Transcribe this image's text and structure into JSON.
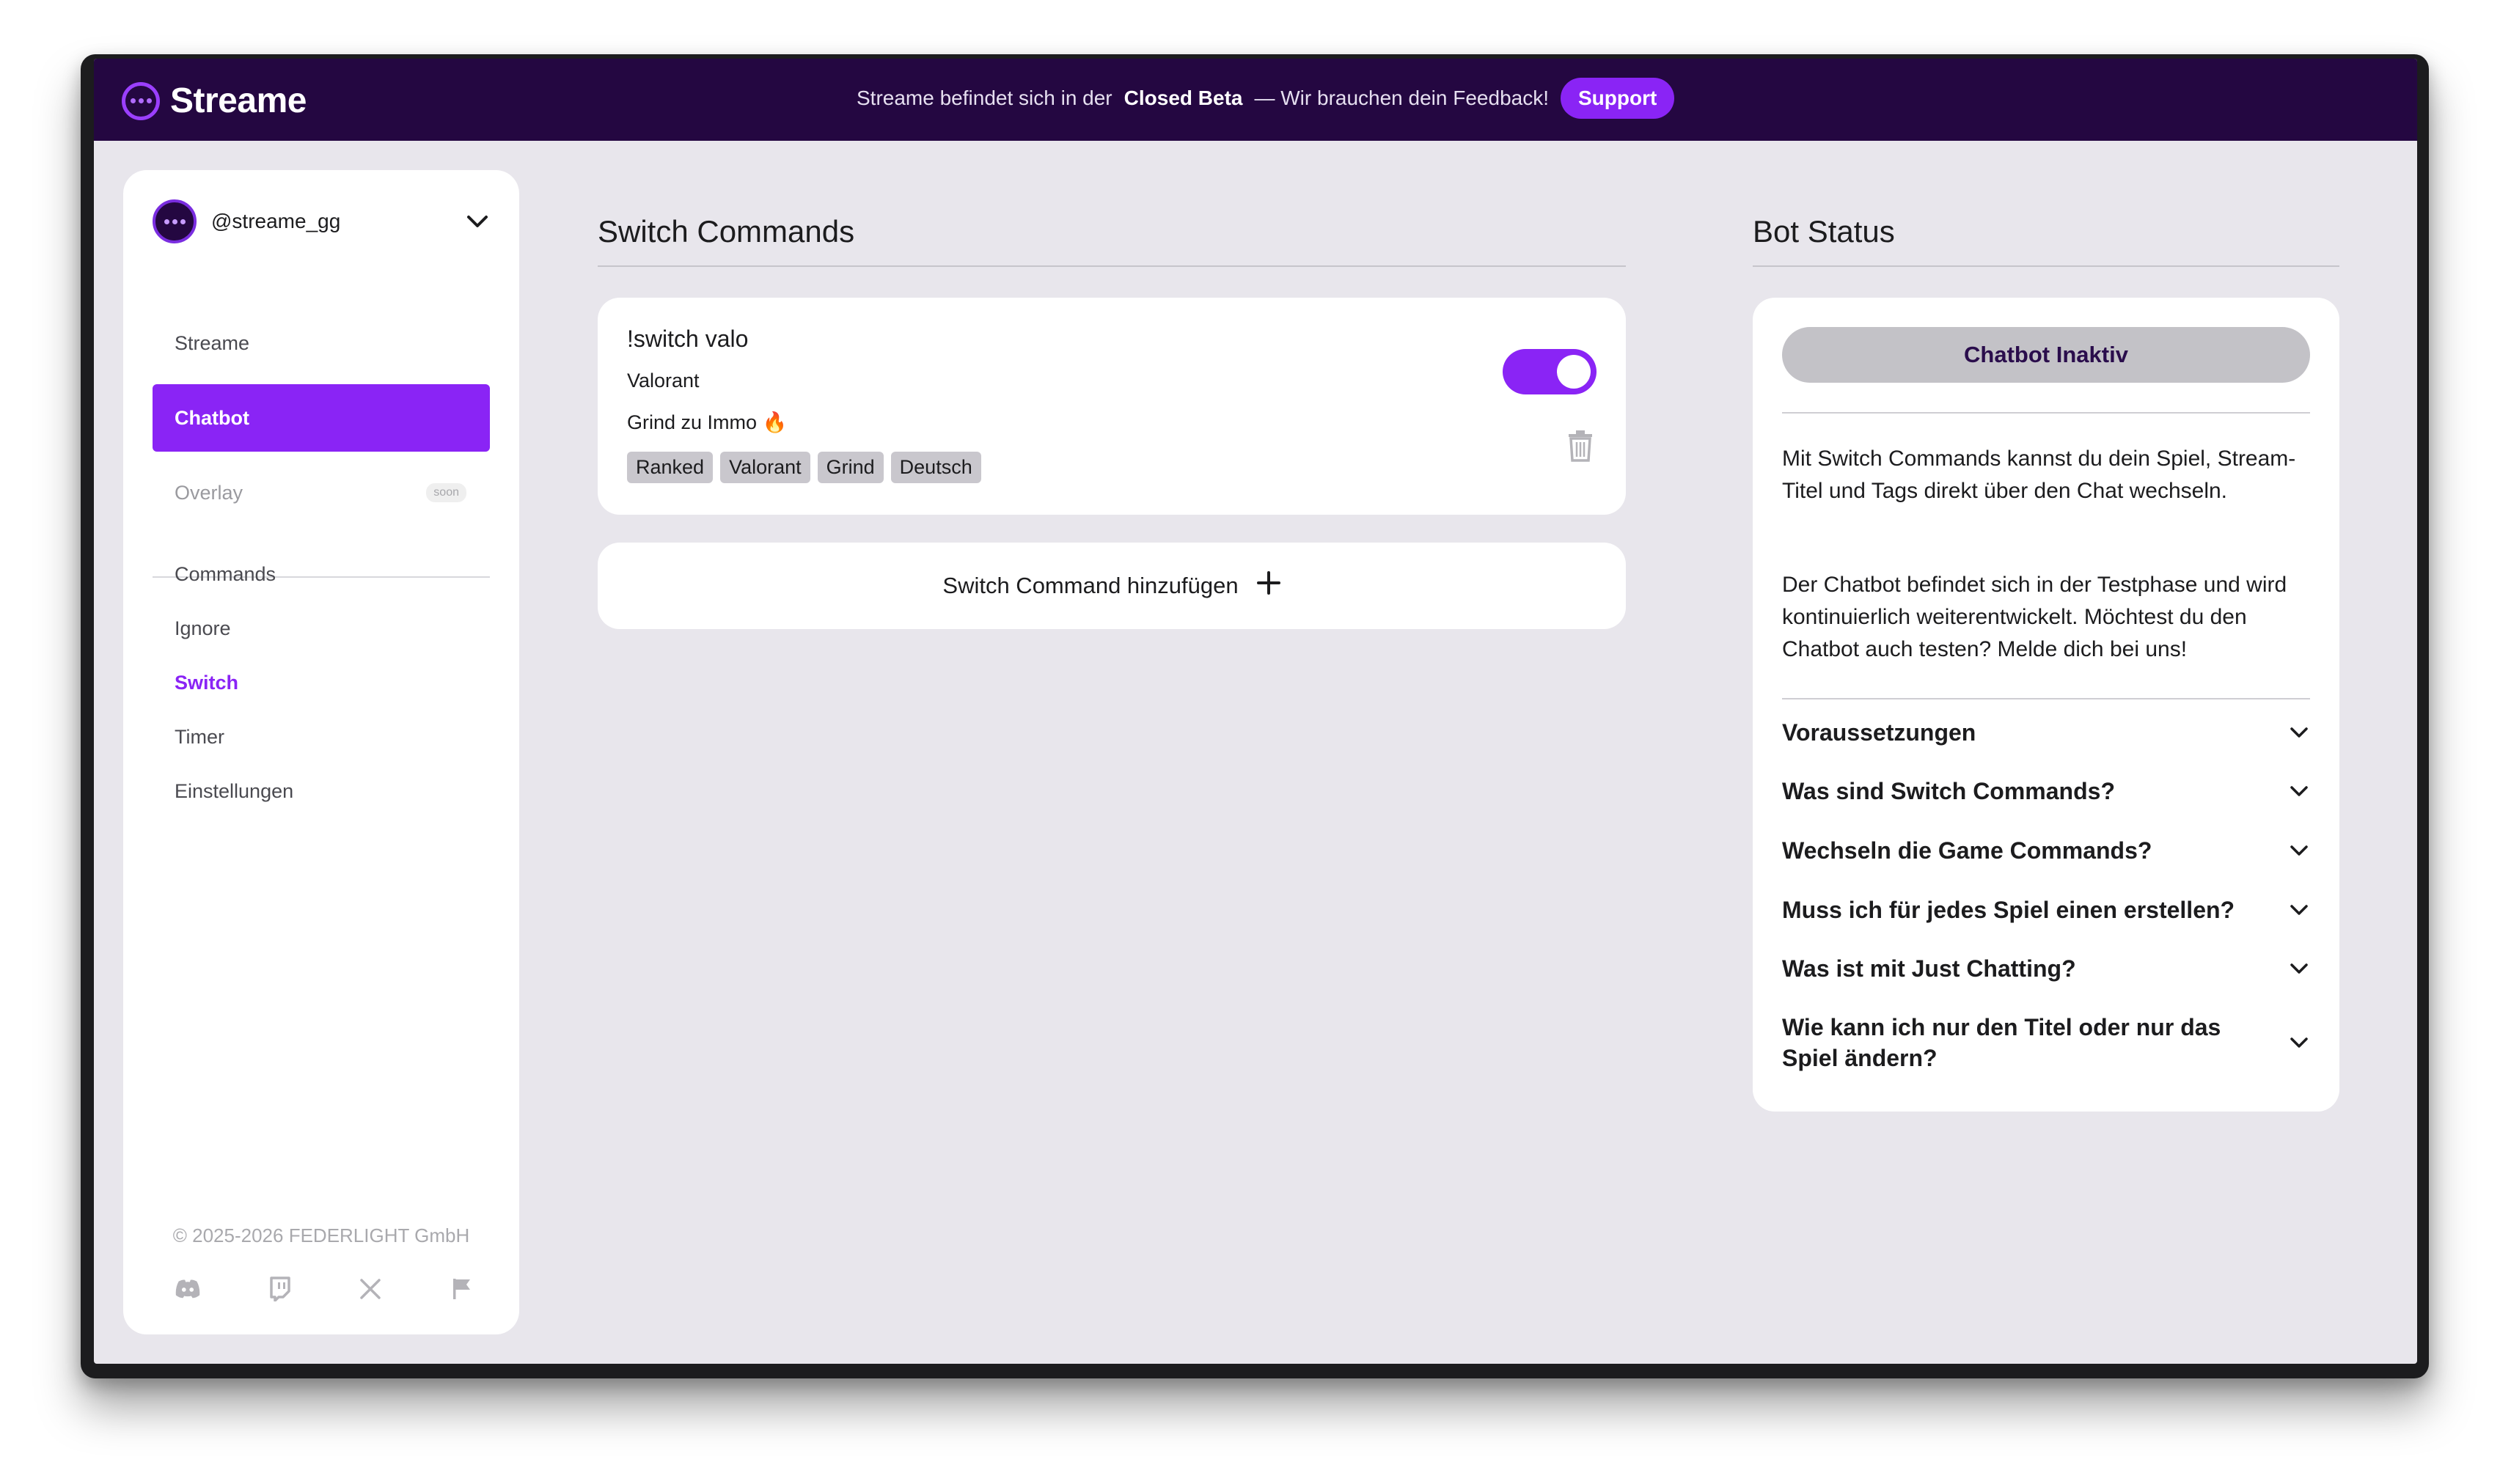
{
  "header": {
    "brand": "Streame",
    "banner_prefix": "Streame befindet sich in der",
    "banner_bold": "Closed Beta",
    "banner_suffix": "— Wir brauchen dein Feedback!",
    "support_label": "Support"
  },
  "sidebar": {
    "account": "@streame_gg",
    "nav": [
      {
        "label": "Streame"
      },
      {
        "label": "Chatbot"
      },
      {
        "label": "Overlay",
        "badge": "soon"
      }
    ],
    "sub_items": [
      {
        "label": "Commands"
      },
      {
        "label": "Ignore"
      },
      {
        "label": "Switch"
      },
      {
        "label": "Timer"
      },
      {
        "label": "Einstellungen"
      }
    ],
    "copyright": "© 2025-2026 FEDERLIGHT GmbH",
    "social": [
      "discord-icon",
      "twitch-icon",
      "x-icon",
      "flag-icon"
    ]
  },
  "main": {
    "title": "Switch Commands",
    "command": {
      "name": "!switch valo",
      "game": "Valorant",
      "stream_title": "Grind zu Immo 🔥",
      "tags": [
        "Ranked",
        "Valorant",
        "Grind",
        "Deutsch"
      ],
      "enabled": true
    },
    "add_label": "Switch Command hinzufügen"
  },
  "bot_status": {
    "title": "Bot Status",
    "status_label": "Chatbot Inaktiv",
    "paragraph1": "Mit Switch Commands kannst du dein Spiel, Stream-Titel und Tags direkt über den Chat wechseln.",
    "paragraph2": "Der Chatbot befindet sich in der Testphase und wird kontinuierlich weiterentwickelt. Möchtest du den Chatbot auch testen? Melde dich bei uns!",
    "faq": [
      "Voraussetzungen",
      "Was sind Switch Commands?",
      "Wechseln die Game Commands?",
      "Muss ich für jedes Spiel einen erstellen?",
      "Was ist mit Just Chatting?",
      "Wie kann ich nur den Titel oder nur das Spiel ändern?"
    ]
  },
  "colors": {
    "accent": "#8a24f5",
    "header_bg": "#240741",
    "page_bg": "#e8e6ec"
  }
}
